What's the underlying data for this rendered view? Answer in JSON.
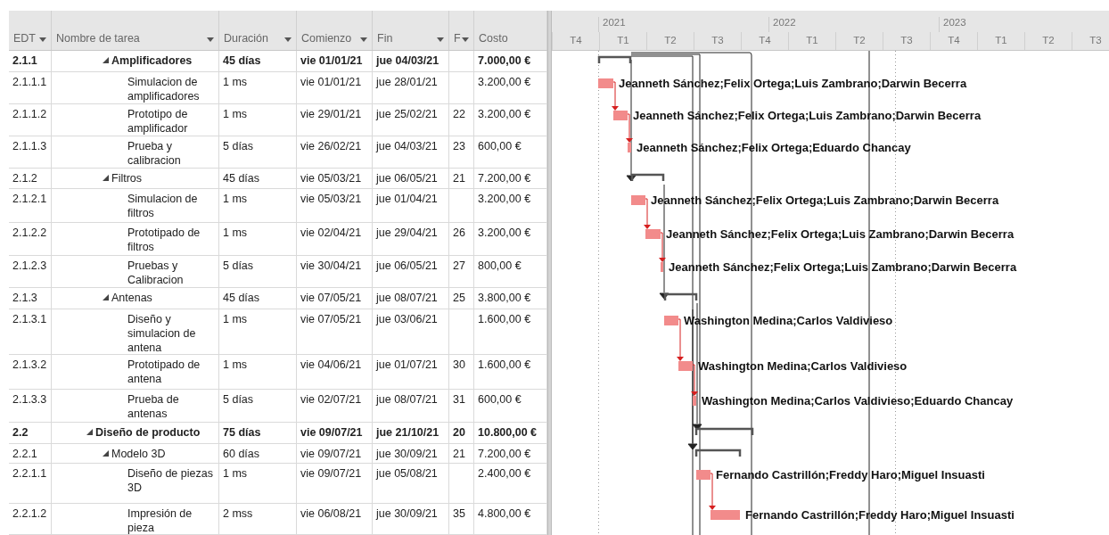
{
  "table": {
    "columns": [
      {
        "label": "EDT",
        "filter": true
      },
      {
        "label": "Nombre de tarea",
        "filter": true
      },
      {
        "label": "Duración",
        "filter": true
      },
      {
        "label": "Comienzo",
        "filter": true
      },
      {
        "label": "Fin",
        "filter": true
      },
      {
        "label": "F",
        "filter": true
      },
      {
        "label": "Costo",
        "filter": false
      }
    ],
    "rows": [
      {
        "children": [
          {
            "wbs": "2.1.1",
            "name": "Amplificadores",
            "duration": "45 días",
            "start": "vie 01/01/21",
            "finish": "jue 04/03/21",
            "cost": "7.000,00 €",
            "kind": "phase",
            "expanded": true,
            "children": [
              {
                "wbs": "2.1.1.1",
                "name": "Simulacion de amplificadores",
                "duration": "1 ms",
                "start": "vie 01/01/21",
                "finish": "jue 28/01/21",
                "cost": "3.200,00 €",
                "kind": "task",
                "resources": "Jeanneth Sánchez;Felix Ortega;Luis Zambrano;Darwin Becerra"
              },
              {
                "wbs": "2.1.1.2",
                "name": "Prototipo de amplificador",
                "duration": "1 ms",
                "start": "vie 29/01/21",
                "finish": "jue 25/02/21",
                "pred": "22",
                "cost": "3.200,00 €",
                "kind": "task",
                "resources": "Jeanneth Sánchez;Felix Ortega;Luis Zambrano;Darwin Becerra"
              },
              {
                "wbs": "2.1.1.3",
                "name": "Prueba y calibracion",
                "duration": "5 días",
                "start": "vie 26/02/21",
                "finish": "jue 04/03/21",
                "pred": "23",
                "cost": "600,00 €",
                "kind": "task",
                "resources": "Jeanneth Sánchez;Felix Ortega;Eduardo Chancay"
              }
            ]
          },
          {
            "wbs": "2.1.2",
            "name": "Filtros",
            "duration": "45 días",
            "start": "vie 05/03/21",
            "finish": "jue 06/05/21",
            "pred": "21",
            "cost": "7.200,00 €",
            "kind": "summary",
            "expanded": true,
            "children": [
              {
                "wbs": "2.1.2.1",
                "name": "Simulacion de filtros",
                "duration": "1 ms",
                "start": "vie 05/03/21",
                "finish": "jue 01/04/21",
                "cost": "3.200,00 €",
                "kind": "task",
                "resources": "Jeanneth Sánchez;Felix Ortega;Luis Zambrano;Darwin Becerra"
              },
              {
                "wbs": "2.1.2.2",
                "name": "Prototipado de filtros",
                "duration": "1 ms",
                "start": "vie 02/04/21",
                "finish": "jue 29/04/21",
                "pred": "26",
                "cost": "3.200,00 €",
                "kind": "task",
                "resources": "Jeanneth Sánchez;Felix Ortega;Luis Zambrano;Darwin Becerra"
              },
              {
                "wbs": "2.1.2.3",
                "name": "Pruebas y Calibracion",
                "duration": "5 días",
                "start": "vie 30/04/21",
                "finish": "jue 06/05/21",
                "pred": "27",
                "cost": "800,00 €",
                "kind": "task",
                "resources": "Jeanneth Sánchez;Felix Ortega;Luis Zambrano;Darwin Becerra"
              }
            ]
          },
          {
            "wbs": "2.1.3",
            "name": "Antenas",
            "duration": "45 días",
            "start": "vie 07/05/21",
            "finish": "jue 08/07/21",
            "pred": "25",
            "cost": "3.800,00 €",
            "kind": "summary",
            "expanded": true,
            "children": [
              {
                "wbs": "2.1.3.1",
                "name": "Diseño y simulacion de antena",
                "duration": "1 ms",
                "start": "vie 07/05/21",
                "finish": "jue 03/06/21",
                "cost": "1.600,00 €",
                "kind": "task",
                "resources": "Washington Medina;Carlos Valdivieso"
              },
              {
                "wbs": "2.1.3.2",
                "name": "Prototipado de antena",
                "duration": "1 ms",
                "start": "vie 04/06/21",
                "finish": "jue 01/07/21",
                "pred": "30",
                "cost": "1.600,00 €",
                "kind": "task",
                "resources": "Washington Medina;Carlos Valdivieso"
              },
              {
                "wbs": "2.1.3.3",
                "name": "Prueba de antenas",
                "duration": "5 días",
                "start": "vie 02/07/21",
                "finish": "jue 08/07/21",
                "pred": "31",
                "cost": "600,00 €",
                "kind": "task",
                "resources": "Washington Medina;Carlos Valdivieso;Eduardo Chancay"
              }
            ]
          }
        ]
      },
      {
        "wbs": "2.2",
        "name": "Diseño de producto",
        "duration": "75 días",
        "start": "vie 09/07/21",
        "finish": "jue 21/10/21",
        "pred": "20",
        "cost": "10.800,00 €",
        "kind": "phase",
        "expanded": true,
        "children": [
          {
            "wbs": "2.2.1",
            "name": "Modelo 3D",
            "duration": "60 días",
            "start": "vie 09/07/21",
            "finish": "jue 30/09/21",
            "pred": "21",
            "cost": "7.200,00 €",
            "kind": "summary",
            "expanded": true,
            "children": [
              {
                "wbs": "2.2.1.1",
                "name": "Diseño de piezas 3D",
                "duration": "1 ms",
                "start": "vie 09/07/21",
                "finish": "jue 05/08/21",
                "cost": "2.400,00 €",
                "kind": "task",
                "resources": "Fernando Castrillón;Freddy Haro;Miguel Insuasti"
              },
              {
                "wbs": "2.2.1.2",
                "name": "Impresión de pieza",
                "duration": "2 mss",
                "start": "vie 06/08/21",
                "finish": "jue 30/09/21",
                "pred": "35",
                "cost": "4.800,00 €",
                "kind": "task",
                "resources": "Fernando Castrillón;Freddy Haro;Miguel Insuasti"
              }
            ]
          }
        ]
      }
    ]
  },
  "timescale": {
    "years": [
      "2021",
      "2022",
      "2023"
    ],
    "quarters": [
      "T4",
      "T1",
      "T2",
      "T3",
      "T4",
      "T1",
      "T2",
      "T3",
      "T4",
      "T1",
      "T2",
      "T3"
    ]
  }
}
